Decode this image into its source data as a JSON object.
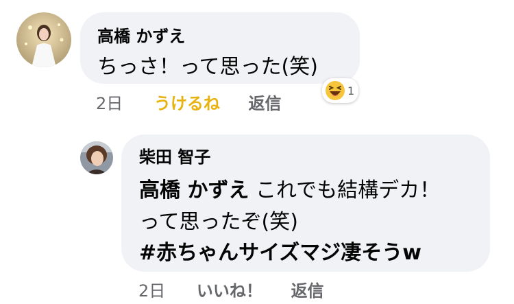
{
  "comment1": {
    "author": "高橋 かずえ",
    "text": "ちっさ！って思った(笑)",
    "time": "2日",
    "reaction_label": "うけるね",
    "reply_label": "返信",
    "reaction_count": "1",
    "reaction_icon": "laughing-emoji-icon",
    "reaction_color": "#e6b310"
  },
  "comment2": {
    "author": "柴田 智子",
    "mention": "高橋 かずえ",
    "line1_rest": " これでも結構デカ！",
    "line2": "って思ったぞ(笑)",
    "hashtag": "#赤ちゃんサイズマジ凄そうw",
    "time": "2日",
    "like_label": "いいね！",
    "reply_label": "返信"
  }
}
